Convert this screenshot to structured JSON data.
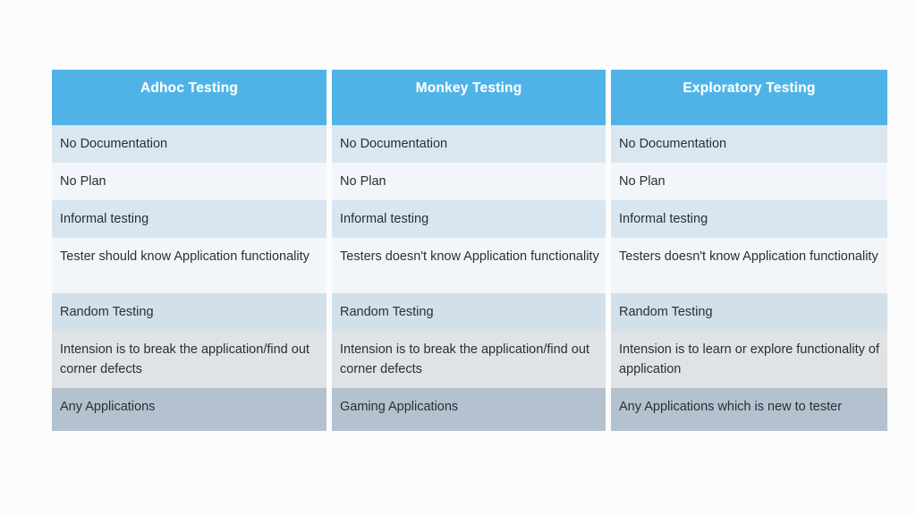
{
  "table": {
    "headers": [
      {
        "label": "Adhoc Testing"
      },
      {
        "label": "Monkey Testing"
      },
      {
        "label": "Exploratory Testing"
      }
    ],
    "rows": [
      {
        "cells": [
          "No Documentation",
          "No Documentation",
          "No Documentation"
        ]
      },
      {
        "cells": [
          "No Plan",
          "No Plan",
          "No Plan"
        ]
      },
      {
        "cells": [
          "Informal testing",
          "Informal testing",
          "Informal testing"
        ]
      },
      {
        "cells": [
          "Tester should know Application functionality",
          "Testers doesn't know Application functionality",
          "Testers doesn't know Application functionality"
        ]
      },
      {
        "cells": [
          "Random Testing",
          "Random Testing",
          "Random Testing"
        ]
      },
      {
        "cells": [
          "Intension is to break the application/find out corner defects",
          "Intension is to break the application/find out corner defects",
          "Intension is to learn or explore functionality of application"
        ]
      },
      {
        "cells": [
          "Any Applications",
          "Gaming Applications",
          "Any Applications which is new to tester"
        ]
      }
    ]
  },
  "colors": {
    "header_background": "#4fb3e8",
    "header_text": "#ffffff",
    "body_text": "#2a2f35",
    "page_background": "#fcfcfc",
    "row_tint_light": "#f2f6fa",
    "row_tint_blue": "#dbe7f0",
    "row_tint_deep": "#b3c2ce"
  }
}
